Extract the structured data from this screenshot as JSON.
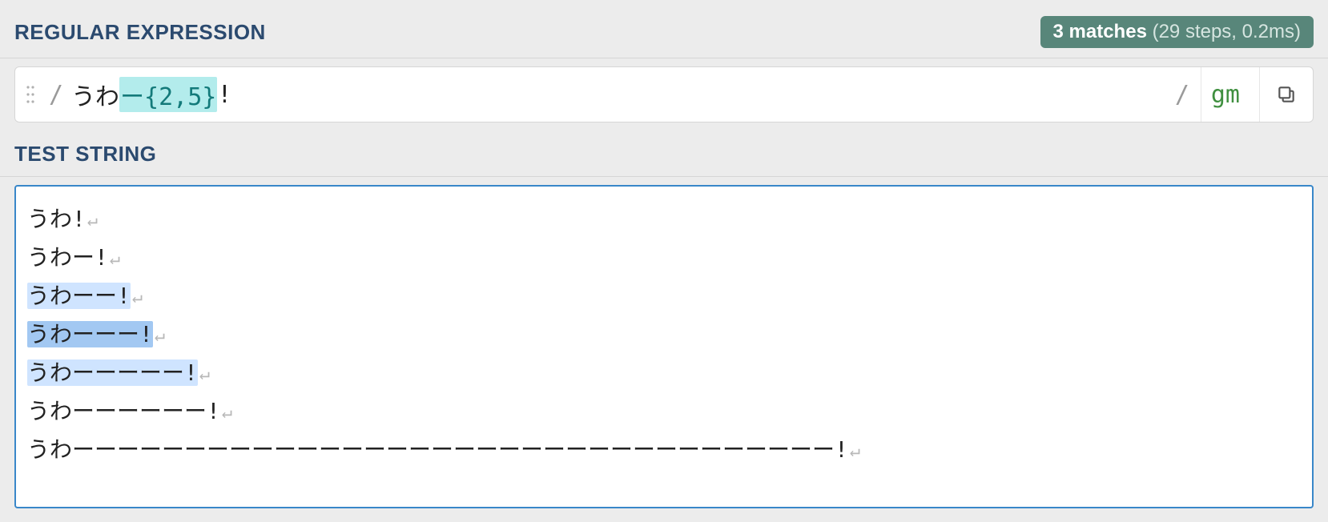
{
  "regex_section_title": "REGULAR EXPRESSION",
  "test_section_title": "TEST STRING",
  "matches": {
    "count_label": "3 matches",
    "detail_label": " (29 steps, 0.2ms)",
    "count": 3,
    "steps": 29,
    "time_ms": 0.2
  },
  "regex": {
    "open_delim": "/",
    "close_delim": "/",
    "flags": "gm",
    "pattern_literal_1": "うわ",
    "pattern_quantified": "ー{2,5}",
    "pattern_literal_2": "!",
    "pattern_full": "うわー{2,5}!"
  },
  "test_string": {
    "newline_glyph": "↵",
    "lines": [
      {
        "segments": [
          {
            "text": "うわ!",
            "match": "none"
          }
        ]
      },
      {
        "segments": [
          {
            "text": "うわー!",
            "match": "none"
          }
        ]
      },
      {
        "segments": [
          {
            "text": "うわーー!",
            "match": "light"
          }
        ]
      },
      {
        "segments": [
          {
            "text": "うわーーー!",
            "match": "med"
          }
        ]
      },
      {
        "segments": [
          {
            "text": "うわーーーーー!",
            "match": "light"
          }
        ]
      },
      {
        "segments": [
          {
            "text": "うわーーーーーー!",
            "match": "none"
          }
        ]
      },
      {
        "segments": [
          {
            "text": "うわーーーーーーーーーーーーーーーーーーーーーーーーーーーーーーーーーー!",
            "match": "none"
          }
        ]
      }
    ]
  }
}
